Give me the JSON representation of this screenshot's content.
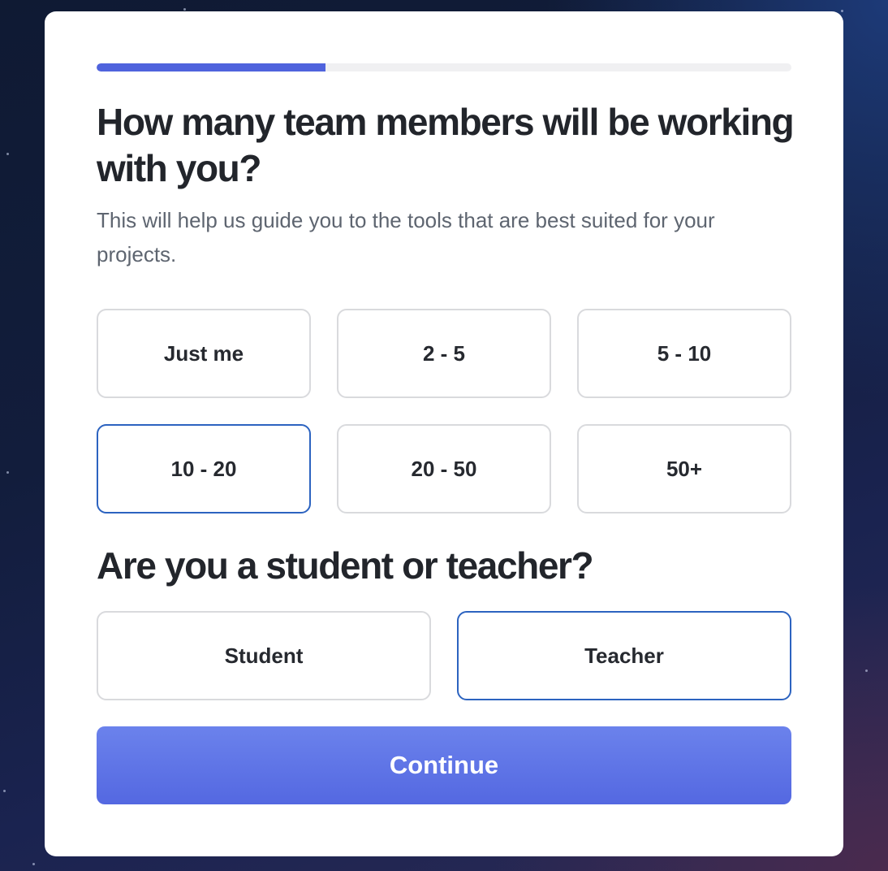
{
  "progress": {
    "fraction": 0.33
  },
  "team_question": {
    "title": "How many team members will be working with you?",
    "subtitle": "This will help us guide you to the tools that are best suited for your projects.",
    "options": [
      "Just me",
      "2 - 5",
      "5 - 10",
      "10 - 20",
      "20 - 50",
      "50+"
    ],
    "selected": "10 - 20"
  },
  "role_question": {
    "title": "Are you a student or teacher?",
    "options": [
      "Student",
      "Teacher"
    ],
    "selected": "Teacher"
  },
  "continue_label": "Continue",
  "colors": {
    "accent": "#4f63dd",
    "selected_border": "#2c63c0",
    "button_top": "#6b82ec",
    "button_bottom": "#5468e1"
  }
}
